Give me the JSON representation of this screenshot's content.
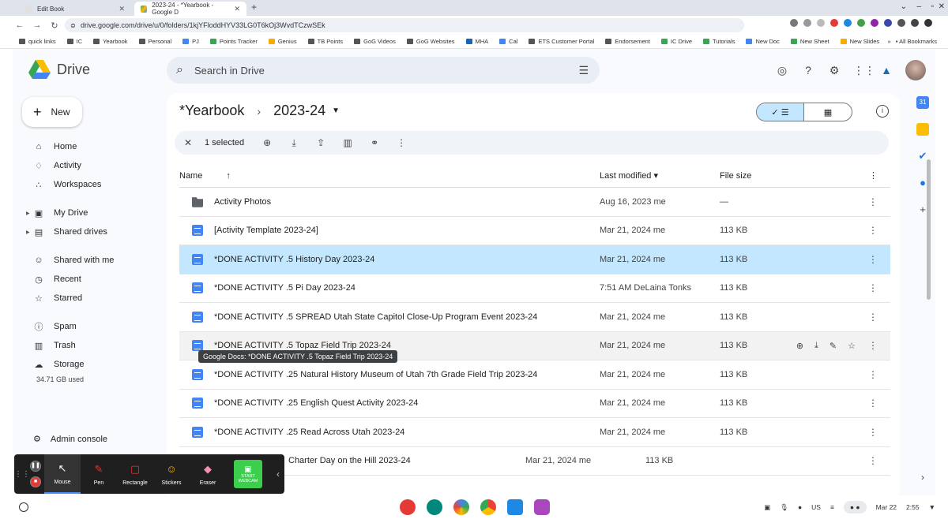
{
  "browser": {
    "tabs": [
      {
        "title": "Edit Book",
        "active": false
      },
      {
        "title": "2023-24 - *Yearbook - Google D",
        "active": true
      }
    ],
    "url": "drive.google.com/drive/u/0/folders/1kjYFloddHYV33LG0T6kOj3WvdTCzwSEk",
    "bookmarks": [
      "quick links",
      "IC",
      "Yearbook",
      "Personal",
      "PJ",
      "Points Tracker",
      "Genius",
      "TB Points",
      "GoG Videos",
      "GoG Websites",
      "MHA",
      "Cal",
      "ETS Customer Portal",
      "Endorsement",
      "IC Drive",
      "Tutorials",
      "New Doc",
      "New Sheet",
      "New Slides"
    ],
    "all_bookmarks": "All Bookmarks",
    "more_bookmarks": "»"
  },
  "drive": {
    "app_name": "Drive",
    "search_placeholder": "Search in Drive",
    "new_label": "New",
    "nav": [
      {
        "label": "Home",
        "icon": "home-icon"
      },
      {
        "label": "Activity",
        "icon": "activity-icon"
      },
      {
        "label": "Workspaces",
        "icon": "workspaces-icon"
      },
      {
        "label": "My Drive",
        "icon": "my-drive-icon"
      },
      {
        "label": "Shared drives",
        "icon": "shared-drives-icon"
      },
      {
        "label": "Shared with me",
        "icon": "shared-with-me-icon"
      },
      {
        "label": "Recent",
        "icon": "recent-icon"
      },
      {
        "label": "Starred",
        "icon": "star-icon"
      },
      {
        "label": "Spam",
        "icon": "spam-icon"
      },
      {
        "label": "Trash",
        "icon": "trash-icon"
      },
      {
        "label": "Storage",
        "icon": "cloud-icon"
      }
    ],
    "storage_used": "34.71 GB used",
    "admin_console": "Admin console",
    "breadcrumb": {
      "parent": "*Yearbook",
      "separator": "›",
      "current": "2023-24"
    },
    "selection": {
      "count_label": "1 selected"
    },
    "columns": {
      "name": "Name",
      "modified": "Last modified",
      "size": "File size"
    },
    "files": [
      {
        "name": "Activity Photos",
        "type": "folder",
        "modified": "Aug 16, 2023 me",
        "size": "—"
      },
      {
        "name": "[Activity Template 2023-24]",
        "type": "doc",
        "modified": "Mar 21, 2024 me",
        "size": "113 KB"
      },
      {
        "name": "*DONE ACTIVITY .5 History Day 2023-24",
        "type": "doc",
        "modified": "Mar 21, 2024 me",
        "size": "113 KB",
        "selected": true
      },
      {
        "name": "*DONE ACTIVITY .5 Pi Day 2023-24",
        "type": "doc",
        "modified": "7:51 AM DeLaina Tonks",
        "size": "113 KB"
      },
      {
        "name": "*DONE ACTIVITY .5 SPREAD Utah State Capitol Close-Up Program Event 2023-24",
        "type": "doc",
        "modified": "Mar 21, 2024 me",
        "size": "113 KB"
      },
      {
        "name": "*DONE ACTIVITY .5 Topaz Field Trip 2023-24",
        "type": "doc",
        "modified": "Mar 21, 2024 me",
        "size": "113 KB",
        "hover": true
      },
      {
        "name": "*DONE ACTIVITY .25  Natural History Museum of Utah  7th Grade Field Trip 2023-24",
        "type": "doc",
        "modified": "Mar 21, 2024 me",
        "size": "113 KB"
      },
      {
        "name": "*DONE ACTIVITY .25 English Quest Activity 2023-24",
        "type": "doc",
        "modified": "Mar 21, 2024 me",
        "size": "113 KB"
      },
      {
        "name": "*DONE ACTIVITY .25 Read Across Utah 2023-24",
        "type": "doc",
        "modified": "Mar 21, 2024 me",
        "size": "113 KB"
      },
      {
        "name": "Charter Day on the Hill 2023-24",
        "type": "doc",
        "modified": "Mar 21, 2024 me",
        "size": "113 KB"
      }
    ],
    "tooltip": "Google Docs: *DONE ACTIVITY .5 Topaz Field Trip 2023-24"
  },
  "recorder": {
    "tools": [
      "Mouse",
      "Pen",
      "Rectangle",
      "Stickers",
      "Eraser"
    ],
    "webcam_line1": "START",
    "webcam_line2": "WEBCAM"
  },
  "shelf": {
    "locale": "US",
    "date": "Mar 22",
    "time": "2:55"
  },
  "colors": {
    "accent": "#0b57d0",
    "selected_row": "#c2e7ff",
    "doc_blue": "#4285f4",
    "webcam_green": "#3ccf4e"
  }
}
